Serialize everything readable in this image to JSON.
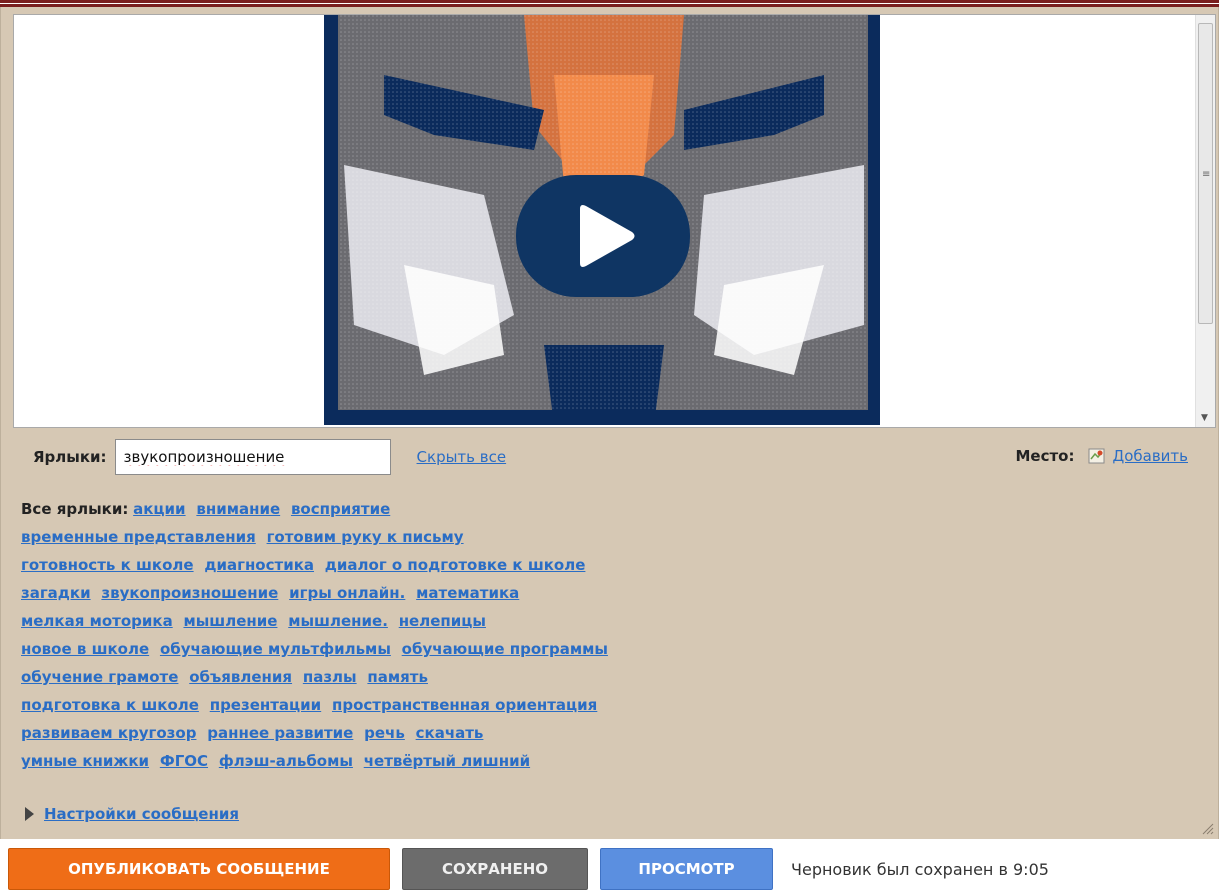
{
  "labels": {
    "title": "Ярлыки:",
    "input_value": "звукопроизношение",
    "hide_all": "Скрыть все"
  },
  "place": {
    "title": "Место:",
    "add": "Добавить",
    "icon": "map-icon"
  },
  "all_labels": {
    "title": "Все ярлыки:",
    "tags": [
      "акции",
      "внимание",
      "восприятие",
      "временные представления",
      "готовим руку к письму",
      "готовность к школе",
      "диагностика",
      "диалог о подготовке к школе",
      "загадки",
      "звукопроизношение",
      "игры онлайн.",
      "математика",
      "мелкая моторика",
      "мышление",
      "мышление.",
      "нелепицы",
      "новое в школе",
      "обучающие мультфильмы",
      "обучающие программы",
      "обучение грамоте",
      "объявления",
      "пазлы",
      "память",
      "подготовка к школе",
      "презентации",
      "пространственная ориентация",
      "развиваем кругозор",
      "раннее развитие",
      "речь",
      "скачать",
      "умные книжки",
      "ФГОС",
      "флэш-альбомы",
      "четвёртый лишний"
    ]
  },
  "settings": {
    "label": "Настройки сообщения"
  },
  "actions": {
    "publish": "ОПУБЛИКОВАТЬ СООБЩЕНИЕ",
    "saved": "СОХРАНЕНО",
    "preview": "ПРОСМОТР",
    "draft_status": "Черновик был сохранен в 9:05"
  },
  "colors": {
    "publish": "#ef6d17",
    "saved": "#6c6c6c",
    "preview": "#5b8fe0",
    "panel": "#d6c8b4",
    "link": "#2a6dc5"
  }
}
